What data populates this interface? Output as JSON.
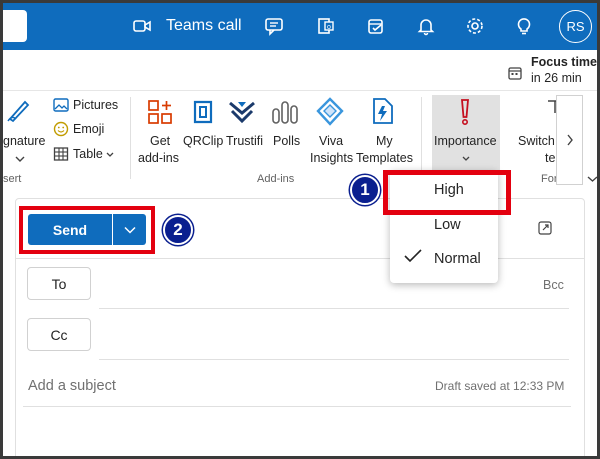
{
  "titlebar": {
    "teams_call_label": "Teams call",
    "avatar_initials": "RS",
    "icons": [
      "video-icon",
      "chat-feedback-icon",
      "office-apps-icon",
      "tasks-icon",
      "bell-icon",
      "gear-icon",
      "lightbulb-icon"
    ]
  },
  "focus": {
    "title": "Focus time",
    "subtitle": "in 26 min"
  },
  "ribbon": {
    "signature_label": "gnature",
    "insert_group_label": "sert",
    "pictures_label": "Pictures",
    "emoji_label": "Emoji",
    "table_label": "Table",
    "get_addins_line1": "Get",
    "get_addins_line2": "add-ins",
    "qrclip_label": "QRClip",
    "trustifi_label": "Trustifi",
    "polls_label": "Polls",
    "viva_line1": "Viva",
    "viva_line2": "Insights",
    "templates_line1": "My",
    "templates_line2": "Templates",
    "addins_group_label": "Add-ins",
    "importance_label": "Importance",
    "switch_line1": "Switch",
    "switch_line2": "te",
    "format_group_label": "For"
  },
  "compose": {
    "send_label": "Send",
    "to_label": "To",
    "cc_label": "Cc",
    "bcc_label": "Bcc",
    "subject_placeholder": "Add a subject",
    "draft_status": "Draft saved at 12:33 PM"
  },
  "importance_menu": {
    "items": [
      {
        "label": "High",
        "checked": false
      },
      {
        "label": "Low",
        "checked": false
      },
      {
        "label": "Normal",
        "checked": true
      }
    ]
  },
  "annotations": {
    "step1": "1",
    "step2": "2"
  },
  "colors": {
    "brand_blue": "#0f6cbd",
    "highlight_red": "#e3000f",
    "badge_navy": "#0a1f8f",
    "importance_red": "#c50f1f"
  }
}
